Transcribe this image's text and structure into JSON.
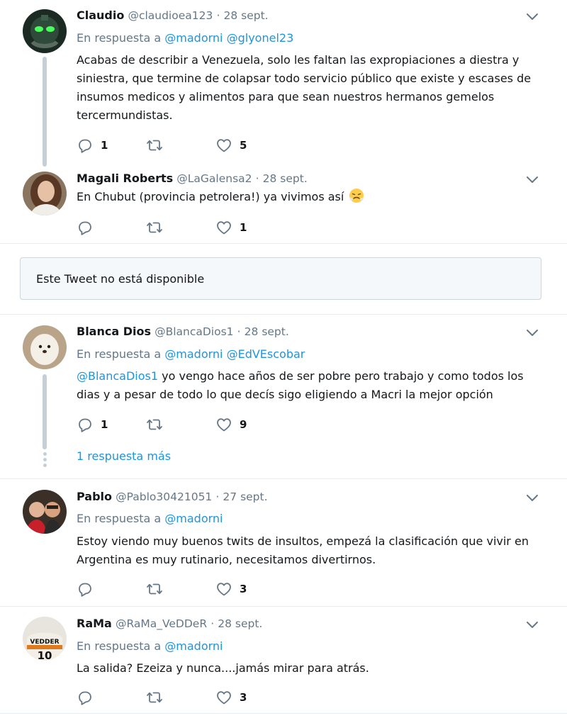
{
  "tweets": [
    {
      "name": "Claudio",
      "handle": "@claudioea123",
      "date": "28 sept.",
      "reply_prefix": "En respuesta a",
      "reply_mentions": [
        "@madorni",
        "@glyonel23"
      ],
      "text": "Acabas de describir a Venezuela, solo les faltan las expropiaciones a diestra y siniestra, que termine de colapsar todo servicio público que existe y escases de insumos medicos y alimentos para que sean nuestros hermanos gemelos tercermundistas.",
      "replies": "1",
      "retweets": "",
      "likes": "5"
    },
    {
      "name": "Magali Roberts",
      "handle": "@LaGalensa2",
      "date": "28 sept.",
      "text": "En Chubut (provincia petrolera!) ya vivimos así",
      "emoji": "😤",
      "replies": "",
      "retweets": "",
      "likes": "1"
    },
    {
      "name": "Blanca Dios",
      "handle": "@BlancaDios1",
      "date": "28 sept.",
      "reply_prefix": "En respuesta a",
      "reply_mentions": [
        "@madorni",
        "@EdVEscobar"
      ],
      "text_mention": "@BlancaDios1",
      "text": " yo vengo hace años de ser pobre pero trabajo y como todos los dias y a pesar de todo lo que decís sigo eligiendo a Macri la mejor opción",
      "replies": "1",
      "retweets": "",
      "likes": "9",
      "more_replies": "1 respuesta más"
    },
    {
      "name": "Pablo",
      "handle": "@Pablo30421051",
      "date": "27 sept.",
      "reply_prefix": "En respuesta a",
      "reply_mentions": [
        "@madorni"
      ],
      "text": "Estoy viendo muy buenos twits de insultos, empezá la clasificación que vivir en Argentina es muy rutinario, necesitamos divertirnos.",
      "replies": "",
      "retweets": "",
      "likes": "3"
    },
    {
      "name": "RaMa",
      "handle": "@RaMa_VeDDeR",
      "date": "28 sept.",
      "reply_prefix": "En respuesta a",
      "reply_mentions": [
        "@madorni"
      ],
      "text": "La salida? Ezeiza y nunca....jamás mirar para atrás.",
      "replies": "",
      "retweets": "",
      "likes": "3"
    }
  ],
  "unavailable": "Este Tweet no está disponible",
  "separator": "·",
  "icons": [
    "reply-icon",
    "retweet-icon",
    "like-icon",
    "chevron-down-icon"
  ],
  "colors": {
    "link": "#1b95e0",
    "muted": "#657786",
    "thread": "#c4cfd6",
    "border": "#e6ecf0"
  }
}
